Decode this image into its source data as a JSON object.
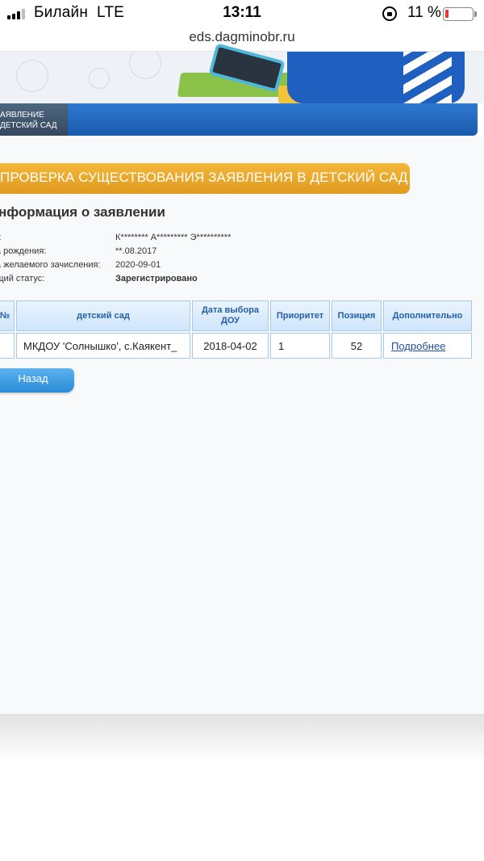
{
  "status_bar": {
    "carrier": "Билайн",
    "network": "LTE",
    "time": "13:11",
    "battery_percent": "11 %",
    "battery_color": "#e53935"
  },
  "browser": {
    "url": "eds.dagminobr.ru"
  },
  "nav": {
    "tab_line1": "АЯВЛЕНИЕ",
    "tab_line2": "ДЕТСКИЙ САД"
  },
  "section": {
    "title": "ПРОВЕРКА СУЩЕСТВОВАНИЯ ЗАЯВЛЕНИЯ В ДЕТСКИЙ САД",
    "heading": "нформация о заявлении"
  },
  "info": [
    {
      "label": "О:",
      "value": "К******** А********* Э**********"
    },
    {
      "label": "та рождения:",
      "value": "**.08.2017"
    },
    {
      "label": "та желаемого зачисления:",
      "value": "2020-09-01"
    },
    {
      "label": "ущий статус:",
      "value": "Зарегистрировано"
    }
  ],
  "table": {
    "headers": [
      "№",
      "детский сад",
      "Дата выбора ДОУ",
      "Приоритет",
      "Позиция",
      "Дополнительно"
    ],
    "rows": [
      {
        "num": "",
        "sad": "МКДОУ 'Солнышко', с.Каякент_",
        "date": "2018-04-02",
        "priority": "1",
        "position": "52",
        "more": "Подробнее"
      }
    ]
  },
  "actions": {
    "back_label": "Назад"
  },
  "colors": {
    "ribbon": "#e9a92a",
    "nav_blue": "#2467c2",
    "table_header_text": "#2460a7"
  }
}
